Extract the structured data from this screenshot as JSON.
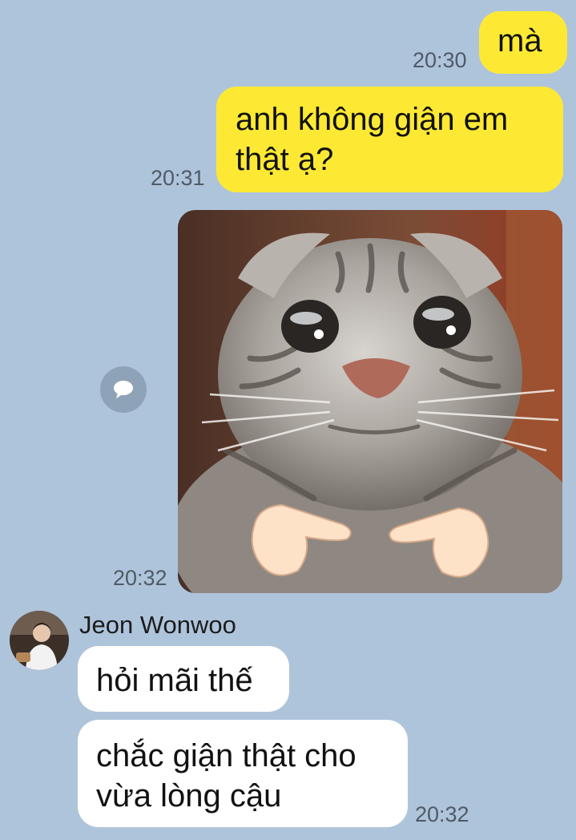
{
  "messages": {
    "out1": {
      "text": "mà",
      "time": "20:30"
    },
    "out2": {
      "line1": "anh không giận em",
      "line2": "thật ạ?",
      "time": "20:31"
    },
    "out3": {
      "type": "image",
      "sticker": "crying-cat-pointing-fingers",
      "time": "20:32"
    },
    "in_sender": "Jeon Wonwoo",
    "in1": {
      "text": "hỏi mãi thế"
    },
    "in2": {
      "line1": "chắc giận thật cho",
      "line2": "vừa lòng cậu",
      "time": "20:32"
    }
  },
  "icons": {
    "share": "speech-bubble-icon"
  },
  "colors": {
    "background": "#aec4db",
    "outgoing_bubble": "#fde934",
    "incoming_bubble": "#ffffff",
    "timestamp": "#4f5b66"
  }
}
